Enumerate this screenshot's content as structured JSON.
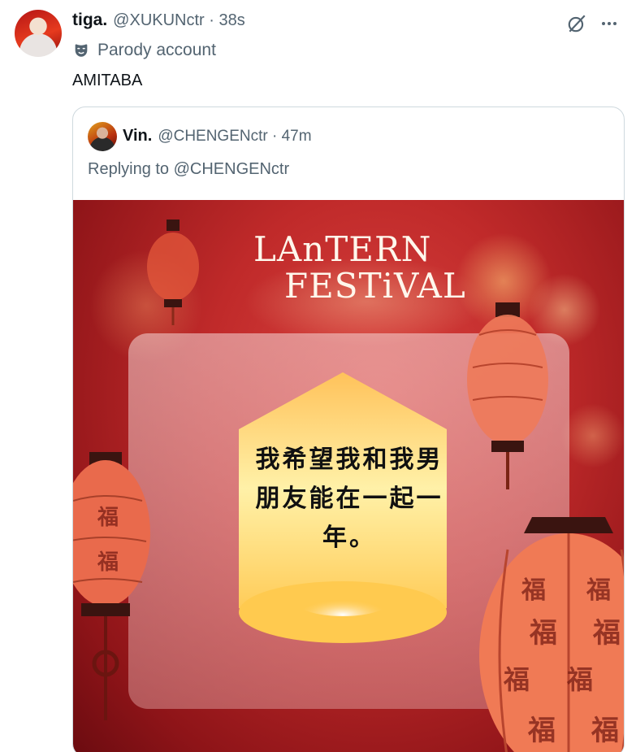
{
  "tweet": {
    "display_name": "tiga.",
    "handle_time": "@XUKUNctr · 38s",
    "parody_label": "Parody account",
    "text": "AMITABA",
    "avatar_icon": "avatar-photo"
  },
  "actions": {
    "grok_icon": "grok-icon",
    "more_icon": "more-icon"
  },
  "quote": {
    "display_name": "Vin.",
    "handle_time": "@CHENGENctr · 47m",
    "replying_to": "Replying to @CHENGENctr"
  },
  "image": {
    "title_line1": "LAnTERN",
    "title_line2": "FESTiVAL",
    "wish_line1": "我希望我和我男",
    "wish_line2": "朋友能在一起一",
    "wish_line3": "年。",
    "fu_char": "福"
  },
  "colors": {
    "text_primary": "#0f1419",
    "text_secondary": "#536471",
    "border": "#cfd9de",
    "festival_red": "#c02a2a"
  }
}
